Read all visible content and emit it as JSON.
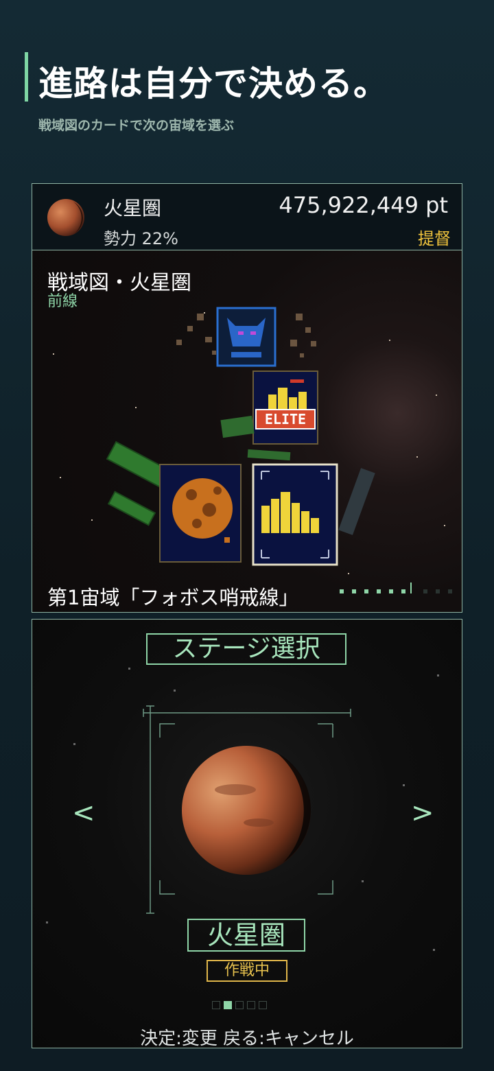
{
  "header": {
    "title": "進路は自分で決める。",
    "subtitle": "戦域図のカードで次の宙域を選ぶ"
  },
  "status_bar": {
    "region_name": "火星圏",
    "influence": "勢力 22%",
    "points": "475,922,449 pt",
    "rank": "提督"
  },
  "map": {
    "title": "戦域図・火星圏",
    "tag": "前線",
    "boss_card_icon": "demon-boss-icon",
    "elite_label": "ELITE",
    "footer": "第1宙域「フォボス哨戒線」",
    "progress": {
      "current": 7,
      "total": 10
    }
  },
  "stage_select": {
    "title": "ステージ選択",
    "prev_arrow": "<",
    "next_arrow": ">",
    "planet_name": "火星圏",
    "status_badge": "作戦中",
    "pager": {
      "count": 5,
      "active_index": 1
    },
    "help_text": "決定:変更  戻る:キャンセル"
  },
  "colors": {
    "accent": "#8fd6a8",
    "rank": "#f2c53d",
    "mars": "#b8603a"
  }
}
